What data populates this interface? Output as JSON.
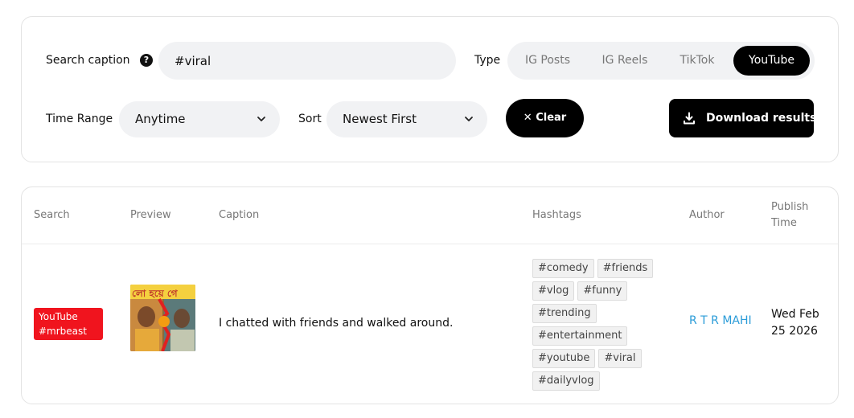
{
  "filters": {
    "search_label": "Search caption",
    "search_value": "#viral",
    "type_label": "Type",
    "types": [
      {
        "label": "IG Posts",
        "active": false
      },
      {
        "label": "IG Reels",
        "active": false
      },
      {
        "label": "TikTok",
        "active": false
      },
      {
        "label": "YouTube",
        "active": true
      }
    ],
    "time_range_label": "Time Range",
    "time_range_value": "Anytime",
    "sort_label": "Sort",
    "sort_value": "Newest First",
    "clear_label": "✕ Clear",
    "download_label": "Download results"
  },
  "table": {
    "columns": [
      "Search",
      "Preview",
      "Caption",
      "Hashtags",
      "Author",
      "Publish Time"
    ],
    "rows": [
      {
        "search_lines": [
          "YouTube",
          "#mrbeast"
        ],
        "caption": "I chatted with friends and walked around.",
        "hashtags": [
          [
            "#comedy",
            "#friends"
          ],
          [
            "#vlog",
            "#funny"
          ],
          [
            "#trending"
          ],
          [
            "#entertainment"
          ],
          [
            "#youtube",
            "#viral"
          ],
          [
            "#dailyvlog"
          ]
        ],
        "thumbnail_text": "লো হয়ে গে",
        "author": "R T R MAHI",
        "publish_time": "Wed Feb 25 2026"
      }
    ]
  },
  "colors": {
    "accent_black": "#000000",
    "badge_red": "#f0141e",
    "link_blue": "#2b9cd8",
    "input_bg": "#f1f2f4"
  }
}
